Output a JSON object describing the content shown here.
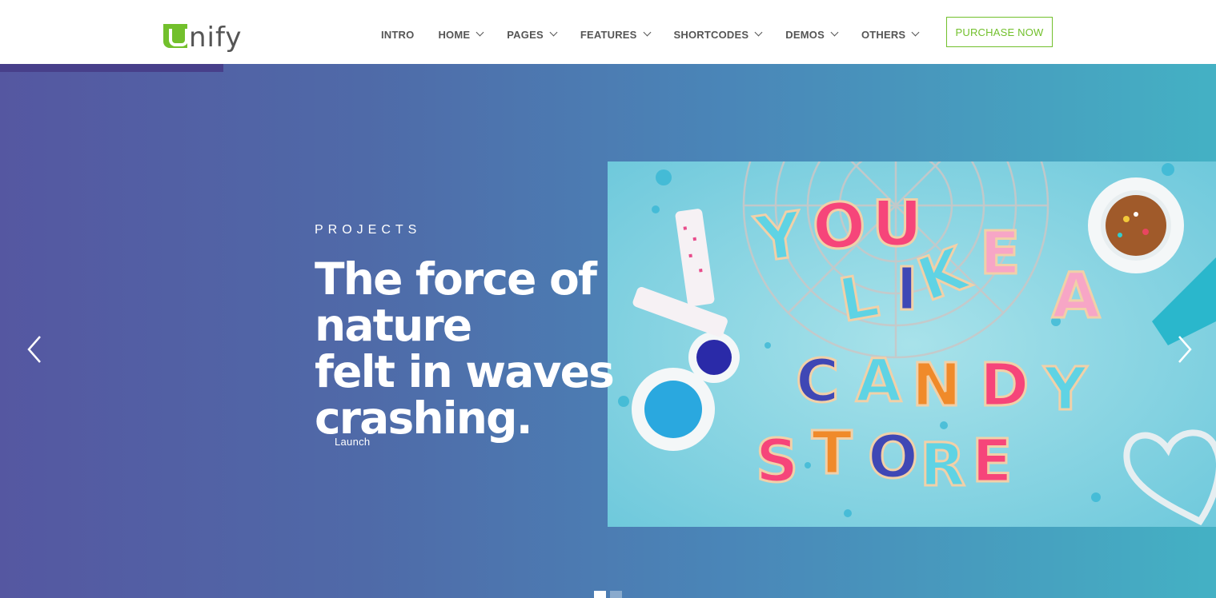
{
  "brand": {
    "logo_text": "nify",
    "logo_accent": "#72c02c"
  },
  "nav": {
    "items": [
      {
        "label": "INTRO",
        "has_dropdown": false
      },
      {
        "label": "HOME",
        "has_dropdown": true
      },
      {
        "label": "PAGES",
        "has_dropdown": true
      },
      {
        "label": "FEATURES",
        "has_dropdown": true
      },
      {
        "label": "SHORTCODES",
        "has_dropdown": true
      },
      {
        "label": "DEMOS",
        "has_dropdown": true
      },
      {
        "label": "OTHERS",
        "has_dropdown": true
      }
    ],
    "purchase_label": "PURCHASE NOW"
  },
  "hero": {
    "eyebrow": "PROJECTS",
    "headline_lines": [
      "The force of nature",
      "felt in waves",
      "crashing."
    ],
    "cta_label": "Launch",
    "image_letters": [
      "YOU",
      "LIKE A",
      "CANDY",
      "STORE"
    ],
    "slide_count": 2,
    "active_slide": 1,
    "gradient": [
      "#5557a1",
      "#44b1c4"
    ]
  }
}
